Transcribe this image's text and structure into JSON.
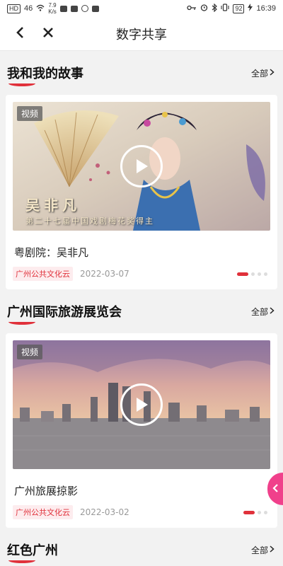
{
  "status_bar": {
    "left_chip": "HD",
    "signal": "46",
    "net_speed_value": "7.9",
    "net_speed_unit": "K/s",
    "battery": "92",
    "time": "16:39"
  },
  "nav": {
    "title": "数字共享"
  },
  "sections": [
    {
      "title": "我和我的故事",
      "all_label": "全部",
      "card": {
        "tag": "视频",
        "overlay_name": "吴非凡",
        "overlay_subtitle": "第二十七届中国戏剧梅花奖得主",
        "title": "粤剧院：吴非凡",
        "source": "广州公共文化云",
        "date": "2022-03-07",
        "dots_total": 4,
        "dots_active": 0
      }
    },
    {
      "title": "广州国际旅游展览会",
      "all_label": "全部",
      "card": {
        "tag": "视频",
        "title": "广州旅展掠影",
        "source": "广州公共文化云",
        "date": "2022-03-02",
        "dots_total": 3,
        "dots_active": 0
      }
    },
    {
      "title": "红色广州",
      "all_label": "全部"
    }
  ],
  "colors": {
    "accent": "#e0313b",
    "float_button": "#f0408b"
  }
}
